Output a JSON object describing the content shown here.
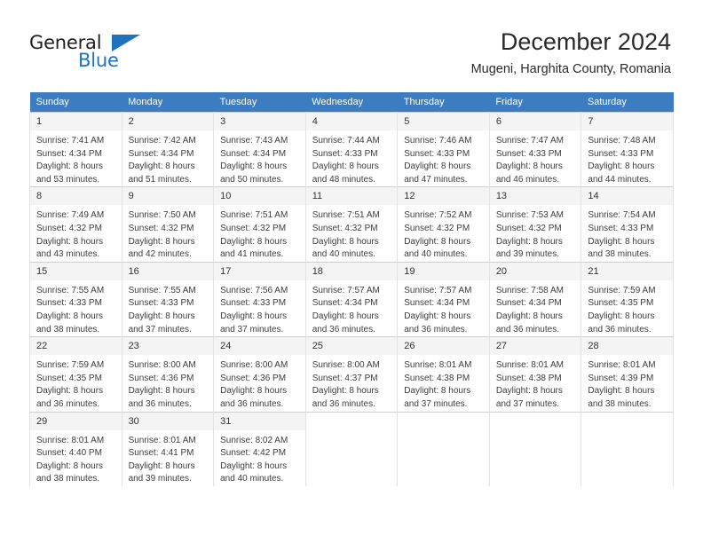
{
  "brand": {
    "name_part1": "General",
    "name_part2": "Blue",
    "accent_color": "#1f72bd"
  },
  "header": {
    "title": "December 2024",
    "location": "Mugeni, Harghita County, Romania"
  },
  "calendar": {
    "header_bg": "#3b7dc0",
    "weekdays": [
      "Sunday",
      "Monday",
      "Tuesday",
      "Wednesday",
      "Thursday",
      "Friday",
      "Saturday"
    ],
    "weeks": [
      [
        {
          "day": "1",
          "sunrise": "Sunrise: 7:41 AM",
          "sunset": "Sunset: 4:34 PM",
          "daylight1": "Daylight: 8 hours",
          "daylight2": "and 53 minutes."
        },
        {
          "day": "2",
          "sunrise": "Sunrise: 7:42 AM",
          "sunset": "Sunset: 4:34 PM",
          "daylight1": "Daylight: 8 hours",
          "daylight2": "and 51 minutes."
        },
        {
          "day": "3",
          "sunrise": "Sunrise: 7:43 AM",
          "sunset": "Sunset: 4:34 PM",
          "daylight1": "Daylight: 8 hours",
          "daylight2": "and 50 minutes."
        },
        {
          "day": "4",
          "sunrise": "Sunrise: 7:44 AM",
          "sunset": "Sunset: 4:33 PM",
          "daylight1": "Daylight: 8 hours",
          "daylight2": "and 48 minutes."
        },
        {
          "day": "5",
          "sunrise": "Sunrise: 7:46 AM",
          "sunset": "Sunset: 4:33 PM",
          "daylight1": "Daylight: 8 hours",
          "daylight2": "and 47 minutes."
        },
        {
          "day": "6",
          "sunrise": "Sunrise: 7:47 AM",
          "sunset": "Sunset: 4:33 PM",
          "daylight1": "Daylight: 8 hours",
          "daylight2": "and 46 minutes."
        },
        {
          "day": "7",
          "sunrise": "Sunrise: 7:48 AM",
          "sunset": "Sunset: 4:33 PM",
          "daylight1": "Daylight: 8 hours",
          "daylight2": "and 44 minutes."
        }
      ],
      [
        {
          "day": "8",
          "sunrise": "Sunrise: 7:49 AM",
          "sunset": "Sunset: 4:32 PM",
          "daylight1": "Daylight: 8 hours",
          "daylight2": "and 43 minutes."
        },
        {
          "day": "9",
          "sunrise": "Sunrise: 7:50 AM",
          "sunset": "Sunset: 4:32 PM",
          "daylight1": "Daylight: 8 hours",
          "daylight2": "and 42 minutes."
        },
        {
          "day": "10",
          "sunrise": "Sunrise: 7:51 AM",
          "sunset": "Sunset: 4:32 PM",
          "daylight1": "Daylight: 8 hours",
          "daylight2": "and 41 minutes."
        },
        {
          "day": "11",
          "sunrise": "Sunrise: 7:51 AM",
          "sunset": "Sunset: 4:32 PM",
          "daylight1": "Daylight: 8 hours",
          "daylight2": "and 40 minutes."
        },
        {
          "day": "12",
          "sunrise": "Sunrise: 7:52 AM",
          "sunset": "Sunset: 4:32 PM",
          "daylight1": "Daylight: 8 hours",
          "daylight2": "and 40 minutes."
        },
        {
          "day": "13",
          "sunrise": "Sunrise: 7:53 AM",
          "sunset": "Sunset: 4:32 PM",
          "daylight1": "Daylight: 8 hours",
          "daylight2": "and 39 minutes."
        },
        {
          "day": "14",
          "sunrise": "Sunrise: 7:54 AM",
          "sunset": "Sunset: 4:33 PM",
          "daylight1": "Daylight: 8 hours",
          "daylight2": "and 38 minutes."
        }
      ],
      [
        {
          "day": "15",
          "sunrise": "Sunrise: 7:55 AM",
          "sunset": "Sunset: 4:33 PM",
          "daylight1": "Daylight: 8 hours",
          "daylight2": "and 38 minutes."
        },
        {
          "day": "16",
          "sunrise": "Sunrise: 7:55 AM",
          "sunset": "Sunset: 4:33 PM",
          "daylight1": "Daylight: 8 hours",
          "daylight2": "and 37 minutes."
        },
        {
          "day": "17",
          "sunrise": "Sunrise: 7:56 AM",
          "sunset": "Sunset: 4:33 PM",
          "daylight1": "Daylight: 8 hours",
          "daylight2": "and 37 minutes."
        },
        {
          "day": "18",
          "sunrise": "Sunrise: 7:57 AM",
          "sunset": "Sunset: 4:34 PM",
          "daylight1": "Daylight: 8 hours",
          "daylight2": "and 36 minutes."
        },
        {
          "day": "19",
          "sunrise": "Sunrise: 7:57 AM",
          "sunset": "Sunset: 4:34 PM",
          "daylight1": "Daylight: 8 hours",
          "daylight2": "and 36 minutes."
        },
        {
          "day": "20",
          "sunrise": "Sunrise: 7:58 AM",
          "sunset": "Sunset: 4:34 PM",
          "daylight1": "Daylight: 8 hours",
          "daylight2": "and 36 minutes."
        },
        {
          "day": "21",
          "sunrise": "Sunrise: 7:59 AM",
          "sunset": "Sunset: 4:35 PM",
          "daylight1": "Daylight: 8 hours",
          "daylight2": "and 36 minutes."
        }
      ],
      [
        {
          "day": "22",
          "sunrise": "Sunrise: 7:59 AM",
          "sunset": "Sunset: 4:35 PM",
          "daylight1": "Daylight: 8 hours",
          "daylight2": "and 36 minutes."
        },
        {
          "day": "23",
          "sunrise": "Sunrise: 8:00 AM",
          "sunset": "Sunset: 4:36 PM",
          "daylight1": "Daylight: 8 hours",
          "daylight2": "and 36 minutes."
        },
        {
          "day": "24",
          "sunrise": "Sunrise: 8:00 AM",
          "sunset": "Sunset: 4:36 PM",
          "daylight1": "Daylight: 8 hours",
          "daylight2": "and 36 minutes."
        },
        {
          "day": "25",
          "sunrise": "Sunrise: 8:00 AM",
          "sunset": "Sunset: 4:37 PM",
          "daylight1": "Daylight: 8 hours",
          "daylight2": "and 36 minutes."
        },
        {
          "day": "26",
          "sunrise": "Sunrise: 8:01 AM",
          "sunset": "Sunset: 4:38 PM",
          "daylight1": "Daylight: 8 hours",
          "daylight2": "and 37 minutes."
        },
        {
          "day": "27",
          "sunrise": "Sunrise: 8:01 AM",
          "sunset": "Sunset: 4:38 PM",
          "daylight1": "Daylight: 8 hours",
          "daylight2": "and 37 minutes."
        },
        {
          "day": "28",
          "sunrise": "Sunrise: 8:01 AM",
          "sunset": "Sunset: 4:39 PM",
          "daylight1": "Daylight: 8 hours",
          "daylight2": "and 38 minutes."
        }
      ],
      [
        {
          "day": "29",
          "sunrise": "Sunrise: 8:01 AM",
          "sunset": "Sunset: 4:40 PM",
          "daylight1": "Daylight: 8 hours",
          "daylight2": "and 38 minutes."
        },
        {
          "day": "30",
          "sunrise": "Sunrise: 8:01 AM",
          "sunset": "Sunset: 4:41 PM",
          "daylight1": "Daylight: 8 hours",
          "daylight2": "and 39 minutes."
        },
        {
          "day": "31",
          "sunrise": "Sunrise: 8:02 AM",
          "sunset": "Sunset: 4:42 PM",
          "daylight1": "Daylight: 8 hours",
          "daylight2": "and 40 minutes."
        },
        {
          "day": "",
          "sunrise": "",
          "sunset": "",
          "daylight1": "",
          "daylight2": ""
        },
        {
          "day": "",
          "sunrise": "",
          "sunset": "",
          "daylight1": "",
          "daylight2": ""
        },
        {
          "day": "",
          "sunrise": "",
          "sunset": "",
          "daylight1": "",
          "daylight2": ""
        },
        {
          "day": "",
          "sunrise": "",
          "sunset": "",
          "daylight1": "",
          "daylight2": ""
        }
      ]
    ]
  }
}
